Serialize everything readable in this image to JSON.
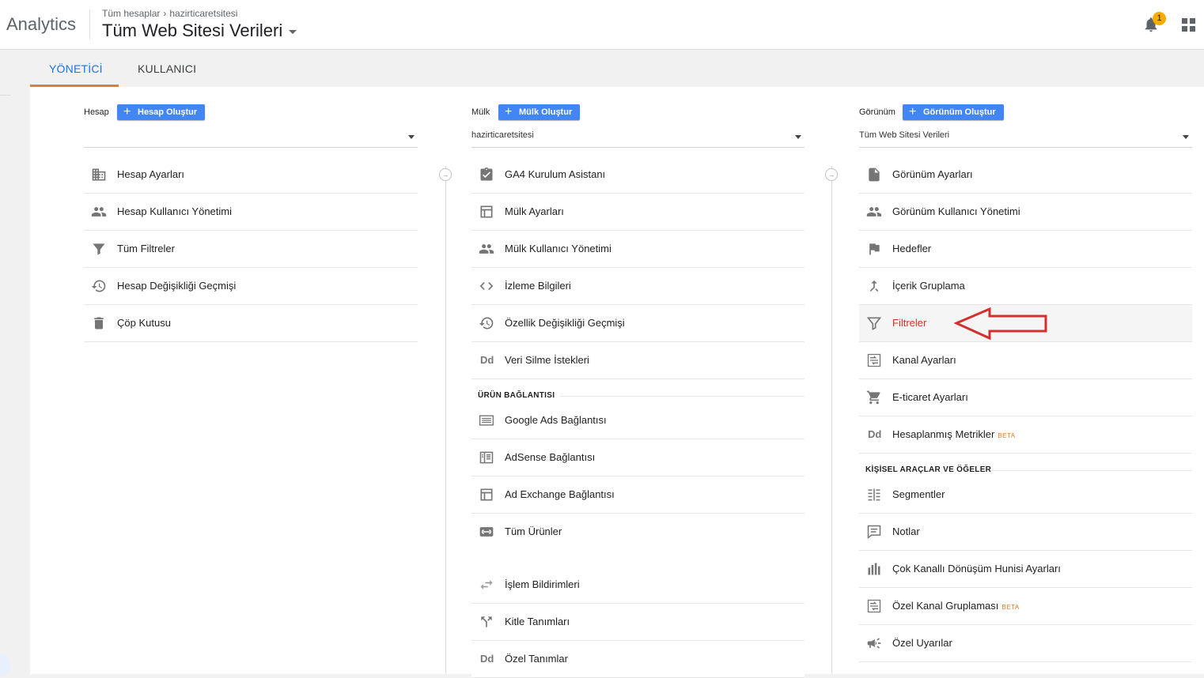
{
  "header": {
    "app_name": "Analytics",
    "breadcrumb_root": "Tüm hesaplar",
    "breadcrumb_account": "hazirticaretsitesi",
    "view_title": "Tüm Web Sitesi Verileri",
    "notification_count": "1"
  },
  "tabs": [
    {
      "label": "YÖNETİCİ",
      "active": true
    },
    {
      "label": "KULLANICI",
      "active": false
    }
  ],
  "columns": {
    "account": {
      "label": "Hesap",
      "create_label": "Hesap Oluştur",
      "selected": "",
      "items": [
        {
          "label": "Hesap Ayarları",
          "icon": "building-icon"
        },
        {
          "label": "Hesap Kullanıcı Yönetimi",
          "icon": "people-icon"
        },
        {
          "label": "Tüm Filtreler",
          "icon": "filter-icon"
        },
        {
          "label": "Hesap Değişikliği Geçmişi",
          "icon": "history-icon"
        },
        {
          "label": "Çöp Kutusu",
          "icon": "trash-icon"
        }
      ]
    },
    "property": {
      "label": "Mülk",
      "create_label": "Mülk Oluştur",
      "selected": "hazirticaretsitesi",
      "items": [
        {
          "label": "GA4 Kurulum Asistanı",
          "icon": "checklist-icon"
        },
        {
          "label": "Mülk Ayarları",
          "icon": "layout-icon"
        },
        {
          "label": "Mülk Kullanıcı Yönetimi",
          "icon": "people-icon"
        },
        {
          "label": "İzleme Bilgileri",
          "icon": "code-icon"
        },
        {
          "label": "Özellik Değişikliği Geçmişi",
          "icon": "history-icon"
        },
        {
          "label": "Veri Silme İstekleri",
          "icon": "dd-icon"
        }
      ],
      "section_title": "ÜRÜN BAĞLANTISI",
      "link_items": [
        {
          "label": "Google Ads Bağlantısı",
          "icon": "ads-icon"
        },
        {
          "label": "AdSense Bağlantısı",
          "icon": "adsense-icon"
        },
        {
          "label": "Ad Exchange Bağlantısı",
          "icon": "layout-icon"
        },
        {
          "label": "Tüm Ürünler",
          "icon": "link-icon"
        }
      ],
      "extra_items": [
        {
          "label": "İşlem Bildirimleri",
          "icon": "swap-icon"
        },
        {
          "label": "Kitle Tanımları",
          "icon": "fork-icon"
        },
        {
          "label": "Özel Tanımlar",
          "icon": "dd-icon"
        }
      ]
    },
    "view": {
      "label": "Görünüm",
      "create_label": "Görünüm Oluştur",
      "selected": "Tüm Web Sitesi Verileri",
      "items": [
        {
          "label": "Görünüm Ayarları",
          "icon": "document-icon"
        },
        {
          "label": "Görünüm Kullanıcı Yönetimi",
          "icon": "people-icon"
        },
        {
          "label": "Hedefler",
          "icon": "flag-icon"
        },
        {
          "label": "İçerik Gruplama",
          "icon": "merge-icon"
        },
        {
          "label": "Filtreler",
          "icon": "filter-icon",
          "active": true
        },
        {
          "label": "Kanal Ayarları",
          "icon": "channel-icon"
        },
        {
          "label": "E-ticaret Ayarları",
          "icon": "cart-icon"
        },
        {
          "label": "Hesaplanmış Metrikler",
          "icon": "dd-icon",
          "badge": "BETA"
        }
      ],
      "section_title": "KİŞİSEL ARAÇLAR VE ÖĞELER",
      "tool_items": [
        {
          "label": "Segmentler",
          "icon": "segments-icon"
        },
        {
          "label": "Notlar",
          "icon": "notes-icon"
        },
        {
          "label": "Çok Kanallı Dönüşüm Hunisi Ayarları",
          "icon": "bars-icon"
        },
        {
          "label": "Özel Kanal Gruplaması",
          "icon": "channel-icon",
          "badge": "BETA"
        },
        {
          "label": "Özel Uyarılar",
          "icon": "megaphone-icon"
        }
      ]
    }
  },
  "colors": {
    "accent_blue": "#4285f4",
    "tab_active": "#1a73e8",
    "tab_underline": "#e67c2a",
    "active_item_text": "#d93025",
    "annotation_arrow": "#d32f2f"
  }
}
